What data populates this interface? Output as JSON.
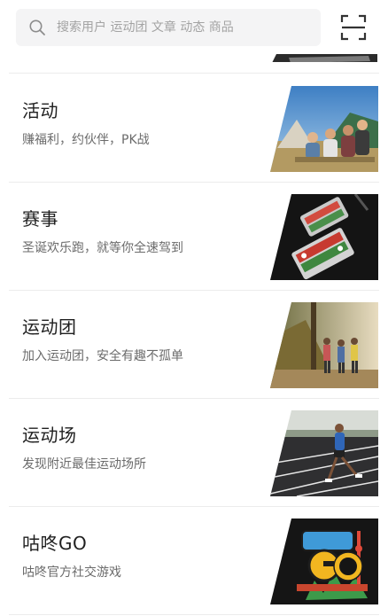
{
  "search": {
    "placeholder": "搜索用户 运动团 文章 动态 商品"
  },
  "icons": {
    "search": "search-icon",
    "scan": "scan-icon"
  },
  "items": [
    {
      "title": "活动",
      "subtitle": "赚福利，约伙伴，PK战",
      "image": "campsite-friends-photo"
    },
    {
      "title": "赛事",
      "subtitle": "圣诞欢乐跑，就等你全速驾到",
      "image": "race-medals-photo"
    },
    {
      "title": "运动团",
      "subtitle": "加入运动团，安全有趣不孤单",
      "image": "group-trail-run-photo"
    },
    {
      "title": "运动场",
      "subtitle": "发现附近最佳运动场所",
      "image": "track-runner-photo"
    },
    {
      "title": "咕咚GO",
      "subtitle": "咕咚官方社交游戏",
      "image": "codoon-go-logo"
    }
  ],
  "colors": {
    "background": "#ffffff",
    "search_bg": "#f4f4f5",
    "title": "#1f1f1f",
    "subtitle": "#6b6b6b",
    "divider": "#ececec"
  }
}
